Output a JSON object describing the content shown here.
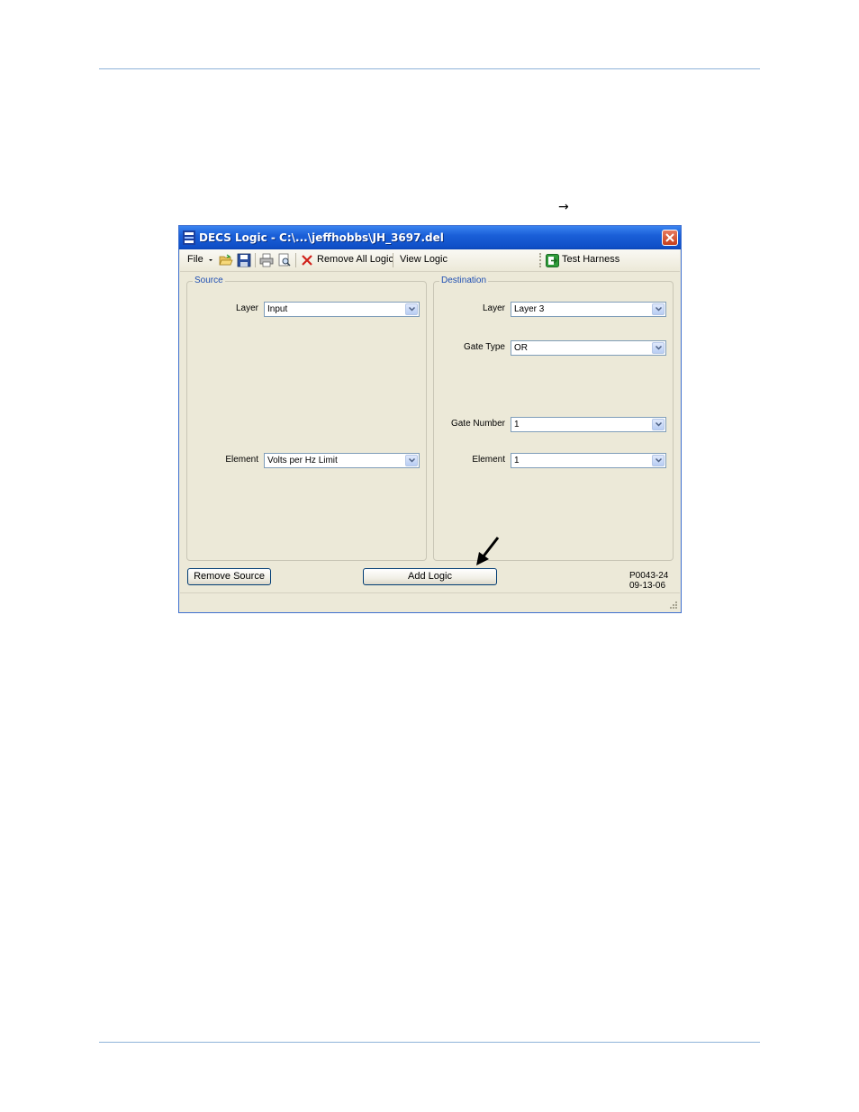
{
  "document": {
    "arrow_glyph": "→"
  },
  "window": {
    "title": "DECS Logic - C:\\...\\jeffhobbs\\JH_3697.del"
  },
  "toolbar": {
    "file_label": "File",
    "remove_all_logic_label": "Remove All Logic",
    "view_logic_label": "View Logic",
    "test_harness_label": "Test Harness"
  },
  "source": {
    "legend": "Source",
    "layer_label": "Layer",
    "layer_value": "Input",
    "element_label": "Element",
    "element_value": "Volts per Hz Limit"
  },
  "destination": {
    "legend": "Destination",
    "layer_label": "Layer",
    "layer_value": "Layer 3",
    "gate_type_label": "Gate Type",
    "gate_type_value": "OR",
    "gate_number_label": "Gate Number",
    "gate_number_value": "1",
    "element_label": "Element",
    "element_value": "1"
  },
  "buttons": {
    "remove_source": "Remove Source",
    "add_logic": "Add Logic"
  },
  "figure_ref": {
    "line1": "P0043-24",
    "line2": "09-13-06"
  },
  "colors": {
    "titlebar": "#0f4fc7",
    "window_bg": "#ece9d8",
    "page_rule": "#8fb3d9",
    "legend_text": "#1f4fb3"
  }
}
